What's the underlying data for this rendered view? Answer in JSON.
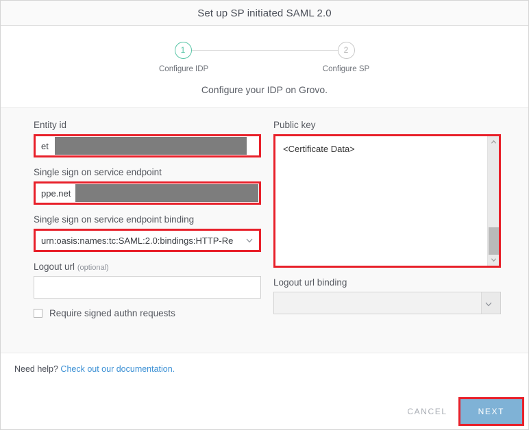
{
  "header": {
    "title": "Set up SP initiated SAML 2.0"
  },
  "stepper": {
    "active_color": "#57c5a6",
    "steps": [
      {
        "number": "1",
        "label": "Configure IDP",
        "state": "active"
      },
      {
        "number": "2",
        "label": "Configure SP",
        "state": "inactive"
      }
    ]
  },
  "subtitle": "Configure your IDP on Grovo.",
  "form": {
    "left": {
      "entity_id": {
        "label": "Entity id",
        "value": "et",
        "redacted": true,
        "highlighted": true
      },
      "sso_endpoint": {
        "label": "Single sign on service endpoint",
        "value": "ppe.net",
        "redacted": true,
        "highlighted": true
      },
      "sso_binding": {
        "label": "Single sign on service endpoint binding",
        "value": "urn:oasis:names:tc:SAML:2.0:bindings:HTTP-Re",
        "highlighted": true,
        "chevron": "chevron-down-icon"
      },
      "logout_url": {
        "label": "Logout url",
        "optional_suffix": "(optional)",
        "value": "",
        "placeholder": ""
      },
      "require_signed": {
        "label": "Require signed authn requests",
        "checked": false
      }
    },
    "right": {
      "public_key": {
        "label": "Public key",
        "value": "<Certificate Data>",
        "highlighted": true,
        "scrollbar": {
          "up_icon": "scroll-up-arrow-icon",
          "down_icon": "scroll-down-arrow-icon"
        }
      },
      "logout_url_binding": {
        "label": "Logout url binding",
        "value": "",
        "disabled": true,
        "chevron": "chevron-down-icon"
      }
    }
  },
  "help": {
    "prefix": "Need help? ",
    "link_text": "Check out our documentation."
  },
  "footer": {
    "cancel_label": "CANCEL",
    "next_label": "NEXT",
    "next_color": "#7fb2d6",
    "next_highlighted": true
  },
  "highlight_color": "#e8202a"
}
